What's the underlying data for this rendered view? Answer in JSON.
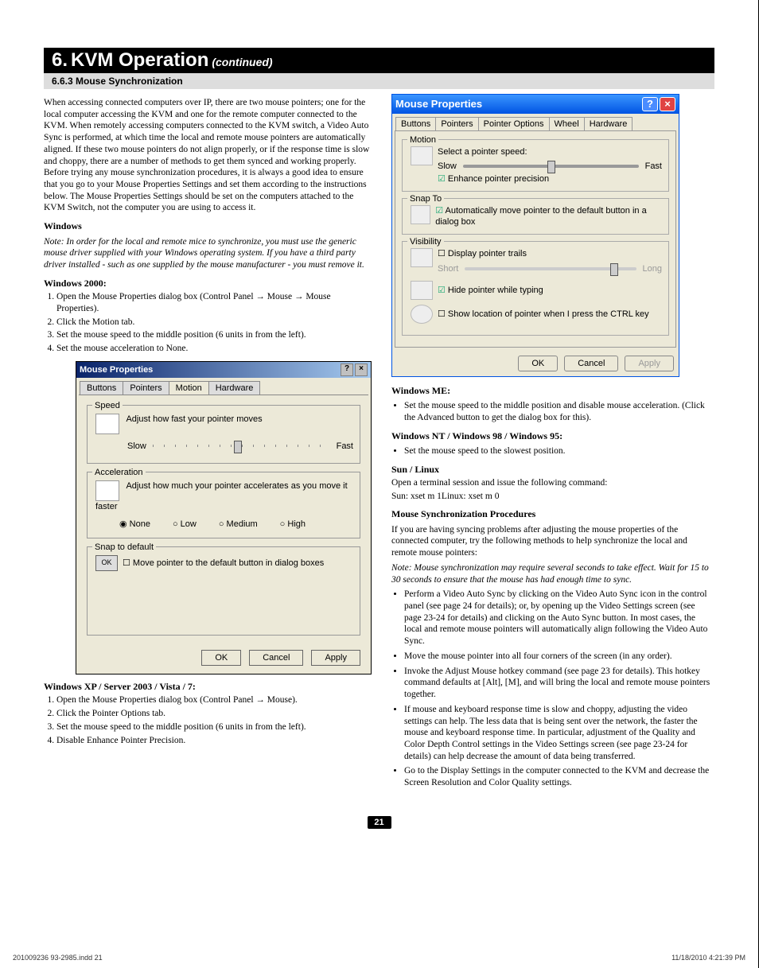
{
  "header": {
    "num": "6.",
    "title": "KVM Operation",
    "cont": "(continued)"
  },
  "subsection": "6.6.3 Mouse Synchronization",
  "left": {
    "intro": "When accessing connected computers over IP, there are two mouse pointers; one for the local computer accessing the KVM and one for the remote computer connected to the KVM. When remotely accessing computers connected to the KVM switch, a Video Auto Sync is performed, at which time the local and remote mouse pointers are automatically aligned. If these two mouse pointers do not align properly, or if the response time is slow and choppy, there are a number of methods to get them synced and working properly. Before trying any mouse synchronization procedures, it is always a good idea to ensure that you go to your Mouse Properties Settings and set them according to the instructions below. The Mouse Properties Settings should be set on the computers attached to the KVM Switch, not the computer you are using to access it.",
    "windows_h": "Windows",
    "windows_note": "Note: In order for the local and remote mice to synchronize, you must use the generic mouse driver supplied with your Windows operating system. If you have a third party driver installed - such as one supplied by the mouse manufacturer - you must remove it.",
    "w2000_h": "Windows 2000:",
    "w2000_steps": [
      "Open the Mouse Properties dialog box (Control Panel → Mouse → Mouse Properties).",
      "Click the Motion tab.",
      "Set the mouse speed to the middle position (6 units in from the left).",
      "Set the mouse acceleration to None."
    ],
    "dlg2000": {
      "title": "Mouse Properties",
      "tabs": [
        "Buttons",
        "Pointers",
        "Motion",
        "Hardware"
      ],
      "speed_legend": "Speed",
      "speed_text": "Adjust how fast your pointer moves",
      "slow": "Slow",
      "fast": "Fast",
      "acc_legend": "Acceleration",
      "acc_text": "Adjust how much your pointer accelerates as you move it faster",
      "radios": [
        "None",
        "Low",
        "Medium",
        "High"
      ],
      "snap_legend": "Snap to default",
      "snap_text": "Move pointer to the default button in dialog boxes",
      "ok": "OK",
      "cancel": "Cancel",
      "apply": "Apply"
    },
    "xp_h": "Windows XP / Server 2003 / Vista / 7:",
    "xp_steps": [
      "Open the Mouse Properties dialog box (Control Panel → Mouse).",
      "Click the Pointer Options tab.",
      "Set the mouse speed to the middle position (6 units in from the left).",
      "Disable Enhance Pointer Precision."
    ]
  },
  "right": {
    "dlgxp": {
      "title": "Mouse Properties",
      "tabs": [
        "Buttons",
        "Pointers",
        "Pointer Options",
        "Wheel",
        "Hardware"
      ],
      "motion_legend": "Motion",
      "motion_text": "Select a pointer speed:",
      "slow": "Slow",
      "fast": "Fast",
      "enhance": "Enhance pointer precision",
      "snap_legend": "Snap To",
      "snap_text": "Automatically move pointer to the default button in a dialog box",
      "vis_legend": "Visibility",
      "trails": "Display pointer trails",
      "short": "Short",
      "long": "Long",
      "hide": "Hide pointer while typing",
      "ctrl": "Show location of pointer when I press the CTRL key",
      "ok": "OK",
      "cancel": "Cancel",
      "apply": "Apply"
    },
    "me_h": "Windows ME:",
    "me_bullet": "Set the mouse speed to the middle position and disable mouse acceleration. (Click the Advanced button to get the dialog box for this).",
    "nt_h": "Windows NT / Windows 98 / Windows 95:",
    "nt_bullet": "Set the mouse speed to the slowest position.",
    "sun_h": "Sun / Linux",
    "sun_text1": "Open a terminal session and issue the following command:",
    "sun_text2": "Sun: xset m 1Linux: xset m 0",
    "proc_h": "Mouse Synchronization Procedures",
    "proc_text": "If you are having syncing problems after adjusting the mouse properties of the connected computer, try the following methods to help synchronize the local and remote mouse pointers:",
    "proc_note": "Note: Mouse synchronization may require several seconds to take effect. Wait for 15 to 30 seconds to ensure that the mouse has had enough time to sync.",
    "proc_bullets": [
      "Perform a Video Auto Sync by clicking on the Video Auto Sync icon in the control panel (see page 24 for details); or, by opening up the Video Settings screen (see page 23-24 for details) and clicking on the Auto Sync button. In most cases, the local and remote mouse pointers will automatically align following the Video Auto Sync.",
      "Move the mouse pointer into all four corners of the screen (in any order).",
      "Invoke the Adjust Mouse hotkey command (see page 23 for details). This hotkey command defaults at [Alt], [M], and will bring the local and remote mouse pointers together.",
      "If mouse and keyboard response time is slow and choppy, adjusting the video settings can help. The less data that is being sent over the network, the faster the mouse and keyboard response time. In particular, adjustment of the Quality and Color Depth Control settings in the Video Settings screen (see page 23-24 for details) can help decrease the amount of data being transferred.",
      "Go to the Display Settings in the computer connected to the KVM and decrease the Screen Resolution and Color Quality settings."
    ]
  },
  "page_num": "21",
  "footer_left": "201009236 93-2985.indd   21",
  "footer_right": "11/18/2010   4:21:39 PM"
}
